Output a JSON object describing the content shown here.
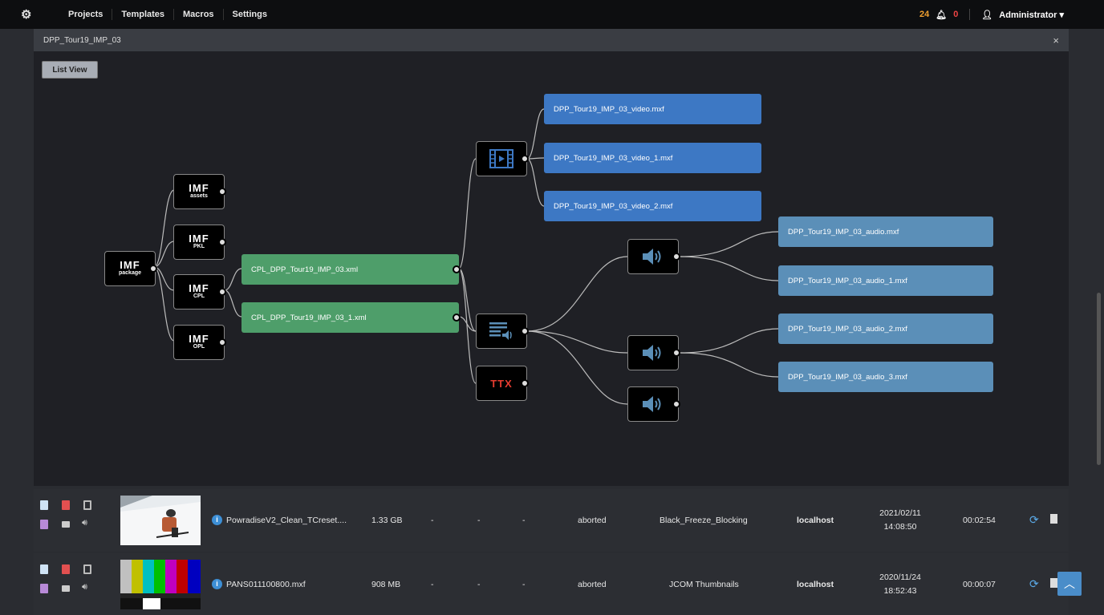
{
  "topbar": {
    "nav": [
      "Projects",
      "Templates",
      "Macros",
      "Settings"
    ],
    "notif_count_orange": "24",
    "notif_count_red": "0",
    "user": "Administrator ▾"
  },
  "modal": {
    "title": "DPP_Tour19_IMP_03",
    "close": "×",
    "list_view": "List View"
  },
  "graph": {
    "root": {
      "big": "IMF",
      "small": "package"
    },
    "imf_nodes": [
      {
        "big": "IMF",
        "small": "assets"
      },
      {
        "big": "IMF",
        "small": "PKL"
      },
      {
        "big": "IMF",
        "small": "CPL"
      },
      {
        "big": "IMF",
        "small": "OPL"
      }
    ],
    "cpl_files": [
      "CPL_DPP_Tour19_IMP_03.xml",
      "CPL_DPP_Tour19_IMP_03_1.xml"
    ],
    "video_files": [
      "DPP_Tour19_IMP_03_video.mxf",
      "DPP_Tour19_IMP_03_video_1.mxf",
      "DPP_Tour19_IMP_03_video_2.mxf"
    ],
    "audio_files": [
      "DPP_Tour19_IMP_03_audio.mxf",
      "DPP_Tour19_IMP_03_audio_1.mxf",
      "DPP_Tour19_IMP_03_audio_2.mxf",
      "DPP_Tour19_IMP_03_audio_3.mxf"
    ],
    "ttx": "TTX"
  },
  "jobs": [
    {
      "name": "PowradiseV2_Clean_TCreset....",
      "size": "1.33 GB",
      "c1": "-",
      "c2": "-",
      "c3": "-",
      "status": "aborted",
      "workflow": "Black_Freeze_Blocking",
      "host": "localhost",
      "date": "2021/02/11",
      "time": "14:08:50",
      "duration": "00:02:54"
    },
    {
      "name": "PANS011100800.mxf",
      "size": "908 MB",
      "c1": "-",
      "c2": "-",
      "c3": "-",
      "status": "aborted",
      "workflow": "JCOM Thumbnails",
      "host": "localhost",
      "date": "2020/11/24",
      "time": "18:52:43",
      "duration": "00:00:07"
    }
  ],
  "colors": {
    "green": "#4e9e6a",
    "blue": "#3d78c4",
    "light_blue": "#5b8fb8",
    "ttx_red": "#e63c30"
  }
}
